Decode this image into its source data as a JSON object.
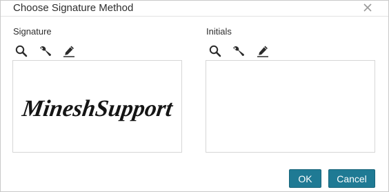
{
  "dialog": {
    "title": "Choose Signature Method",
    "close_icon": "close-icon"
  },
  "signature": {
    "label": "Signature",
    "value": "MineshSupport",
    "tools": [
      "search-icon",
      "wrench-icon",
      "pen-icon"
    ]
  },
  "initials": {
    "label": "Initials",
    "value": "",
    "tools": [
      "search-icon",
      "wrench-icon",
      "pen-icon"
    ]
  },
  "buttons": {
    "ok_label": "OK",
    "cancel_label": "Cancel"
  },
  "colors": {
    "button_bg": "#1f7a94",
    "button_text": "#ffffff",
    "icon": "#2b2b2b",
    "signature_ink": "#151515"
  }
}
